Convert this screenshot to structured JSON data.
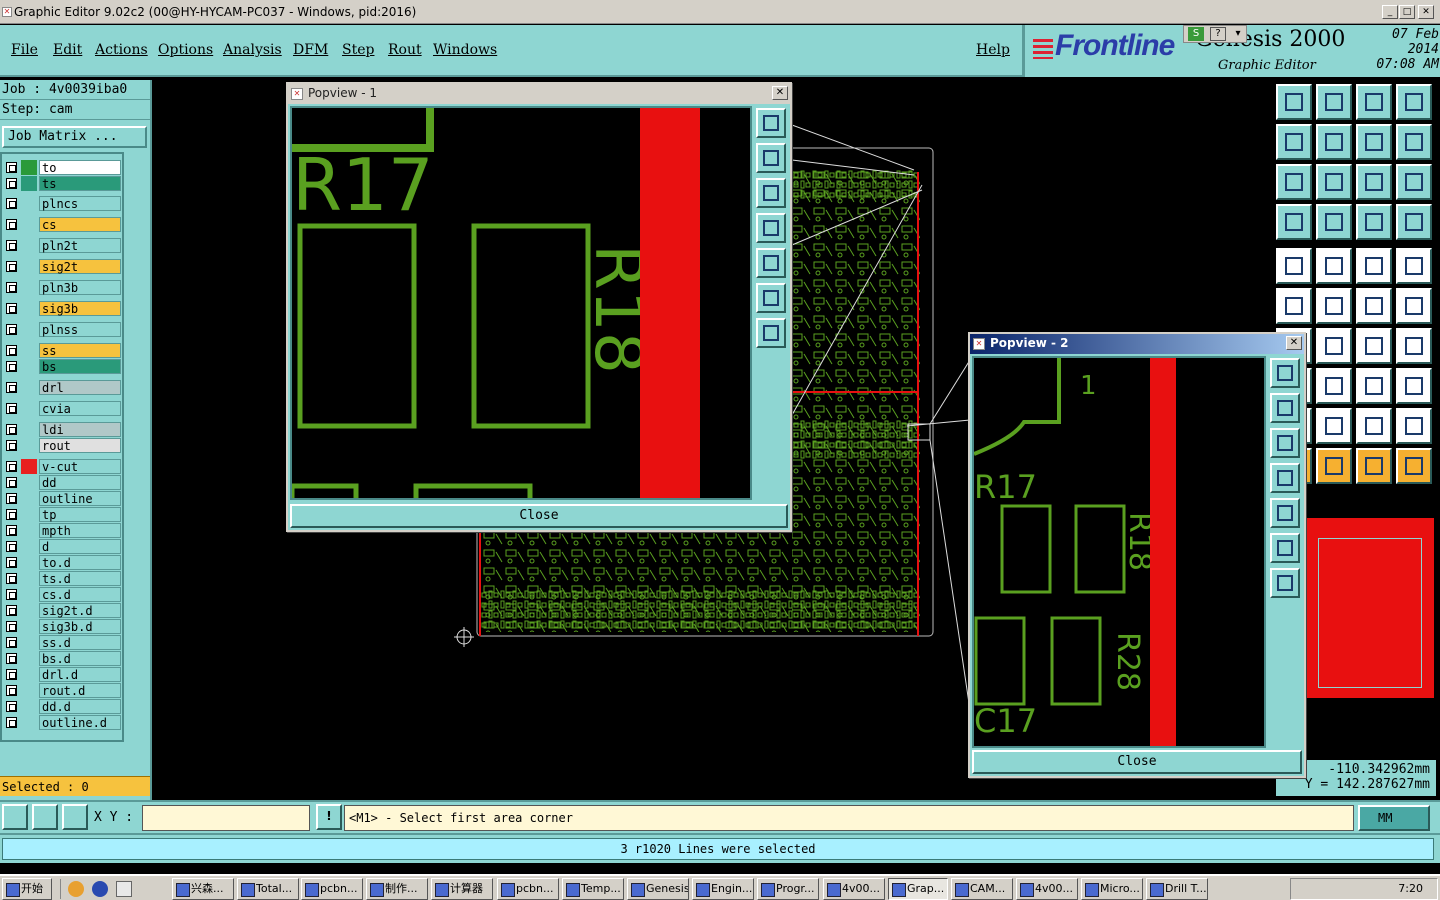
{
  "window": {
    "title": "Graphic Editor 9.02c2 (00@HY-HYCAM-PC037 - Windows, pid:2016)"
  },
  "menu": [
    "File",
    "Edit",
    "Actions",
    "Options",
    "Analysis",
    "DFM",
    "Step",
    "Rout",
    "Windows"
  ],
  "help": "Help",
  "brand": {
    "logo": "Frontline",
    "product": "Genesis 2000",
    "subtitle": "Graphic Editor",
    "date": "07 Feb 2014",
    "time": "07:08 AM"
  },
  "job": {
    "job_line": "Job : 4v0039iba0",
    "step_line": "Step: cam",
    "matrix_button": "Job Matrix ..."
  },
  "layers": [
    {
      "name": "to",
      "color": "#ffffff",
      "swatch": "#2a9a3a"
    },
    {
      "name": "ts",
      "color": "#2a9a7a",
      "swatch": "#2a9a7a"
    },
    {
      "name": "plncs",
      "color": "#8ed6d2",
      "swatch": ""
    },
    {
      "name": "cs",
      "color": "#f6c23e",
      "swatch": ""
    },
    {
      "name": "pln2t",
      "color": "#8ed6d2",
      "swatch": ""
    },
    {
      "name": "sig2t",
      "color": "#f6c23e",
      "swatch": ""
    },
    {
      "name": "pln3b",
      "color": "#8ed6d2",
      "swatch": ""
    },
    {
      "name": "sig3b",
      "color": "#f6c23e",
      "swatch": ""
    },
    {
      "name": "plnss",
      "color": "#8ed6d2",
      "swatch": ""
    },
    {
      "name": "ss",
      "color": "#f6c23e",
      "swatch": ""
    },
    {
      "name": "bs",
      "color": "#2a9a7a",
      "swatch": ""
    },
    {
      "name": "drl",
      "color": "#b0c8c8",
      "swatch": ""
    },
    {
      "name": "cvia",
      "color": "#8ed6d2",
      "swatch": ""
    },
    {
      "name": "ldi",
      "color": "#b0c8c8",
      "swatch": ""
    },
    {
      "name": "rout",
      "color": "#e0e0e0",
      "swatch": ""
    },
    {
      "name": "v-cut",
      "color": "#8ed6d2",
      "swatch": "#e82020"
    },
    {
      "name": "dd",
      "color": "#8ed6d2",
      "swatch": ""
    },
    {
      "name": "outline",
      "color": "#8ed6d2",
      "swatch": ""
    },
    {
      "name": "tp",
      "color": "#8ed6d2",
      "swatch": ""
    },
    {
      "name": "mpth",
      "color": "#8ed6d2",
      "swatch": ""
    },
    {
      "name": "d",
      "color": "#8ed6d2",
      "swatch": ""
    },
    {
      "name": "to.d",
      "color": "#8ed6d2",
      "swatch": ""
    },
    {
      "name": "ts.d",
      "color": "#8ed6d2",
      "swatch": ""
    },
    {
      "name": "cs.d",
      "color": "#8ed6d2",
      "swatch": ""
    },
    {
      "name": "sig2t.d",
      "color": "#8ed6d2",
      "swatch": ""
    },
    {
      "name": "sig3b.d",
      "color": "#8ed6d2",
      "swatch": ""
    },
    {
      "name": "ss.d",
      "color": "#8ed6d2",
      "swatch": ""
    },
    {
      "name": "bs.d",
      "color": "#8ed6d2",
      "swatch": ""
    },
    {
      "name": "drl.d",
      "color": "#8ed6d2",
      "swatch": ""
    },
    {
      "name": "rout.d",
      "color": "#8ed6d2",
      "swatch": ""
    },
    {
      "name": "dd.d",
      "color": "#8ed6d2",
      "swatch": ""
    },
    {
      "name": "outline.d",
      "color": "#8ed6d2",
      "swatch": ""
    }
  ],
  "selected": "Selected : 0",
  "popview1": {
    "title": "Popview - 1",
    "close": "Close",
    "labels": [
      "R17",
      "R18"
    ]
  },
  "popview2": {
    "title": "Popview - 2",
    "close": "Close",
    "labels": [
      "1",
      "R17",
      "R18",
      "R28",
      "C17"
    ]
  },
  "coords": {
    "x": "-110.342962mm",
    "y": "Y = 142.287627mm"
  },
  "command": {
    "xy_label": "X Y :",
    "prompt": "<M1> - Select first area corner",
    "units": "MM"
  },
  "status": "3 r1020 Lines were selected",
  "taskbar": {
    "start": "开始",
    "items": [
      "兴森...",
      "Total...",
      "pcbn...",
      "制作...",
      "计算器",
      "pcbn...",
      "Temp...",
      "Genesis",
      "Engin...",
      "Progr...",
      "4v00...",
      "Grap...",
      "CAM...",
      "4v00...",
      "Micro...",
      "Drill T..."
    ],
    "clock": "7:20"
  },
  "colors": {
    "accent": "#8ed6d2",
    "pcb_green": "#5aa020",
    "vcut_red": "#e81010"
  }
}
